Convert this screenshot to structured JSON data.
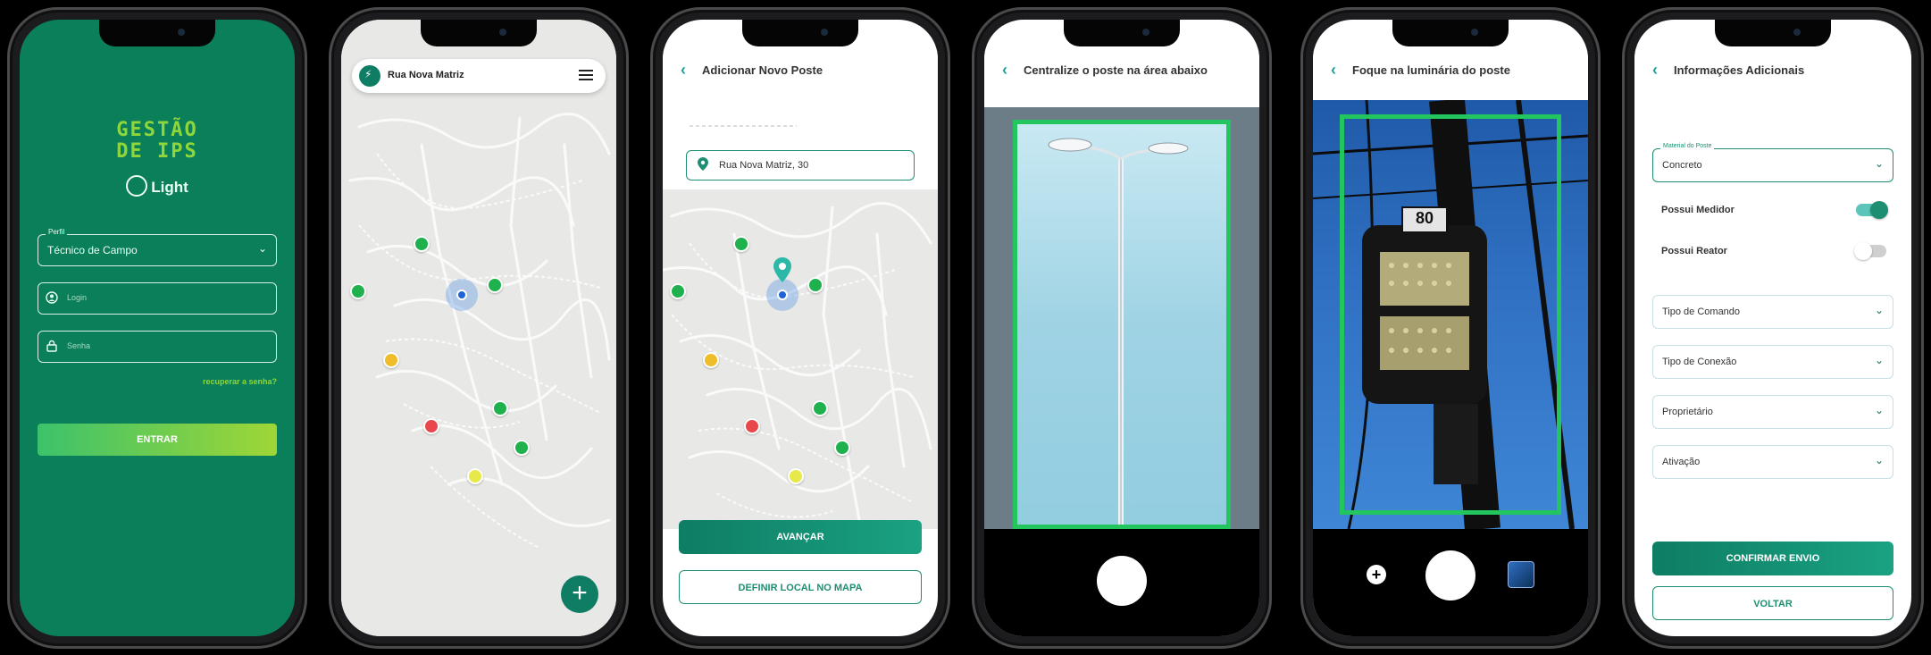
{
  "screen1": {
    "logo_line1": "GESTÃO",
    "logo_line2": "DE IPS",
    "brand": "Light",
    "perfil_label": "Perfil",
    "perfil_value": "Técnico de Campo",
    "login_placeholder": "Login",
    "senha_placeholder": "Senha",
    "recover_link": "recuperar a senha?",
    "enter_button": "ENTRAR"
  },
  "screen2": {
    "search_text": "Rua Nova Matriz",
    "add_button": "+"
  },
  "screen3": {
    "title": "Adicionar Novo Poste",
    "address": "Rua Nova Matriz, 30",
    "primary_button": "AVANÇAR",
    "secondary_button": "DEFINIR LOCAL NO MAPA"
  },
  "screen4": {
    "title": "Centralize o poste na área abaixo"
  },
  "screen5": {
    "title": "Foque na luminária do poste",
    "pole_number": "80",
    "add_icon": "plus-circle-icon",
    "gallery_icon": "gallery-icon"
  },
  "screen6": {
    "title": "Informações Adicionais",
    "material_label": "Material do Poste",
    "material_value": "Concreto",
    "toggle1_label": "Possui Medidor",
    "toggle1_on": true,
    "toggle2_label": "Possui Reator",
    "toggle2_on": false,
    "dropdowns": [
      "Tipo de Comando",
      "Tipo de Conexão",
      "Proprietário",
      "Ativação"
    ],
    "confirm_button": "CONFIRMAR ENVIO",
    "back_button": "VOLTAR"
  },
  "colors": {
    "primary": "#0e7d63",
    "accent_green": "#8fd63b",
    "frame_green": "#22c55e",
    "teal": "#1aa19a"
  }
}
